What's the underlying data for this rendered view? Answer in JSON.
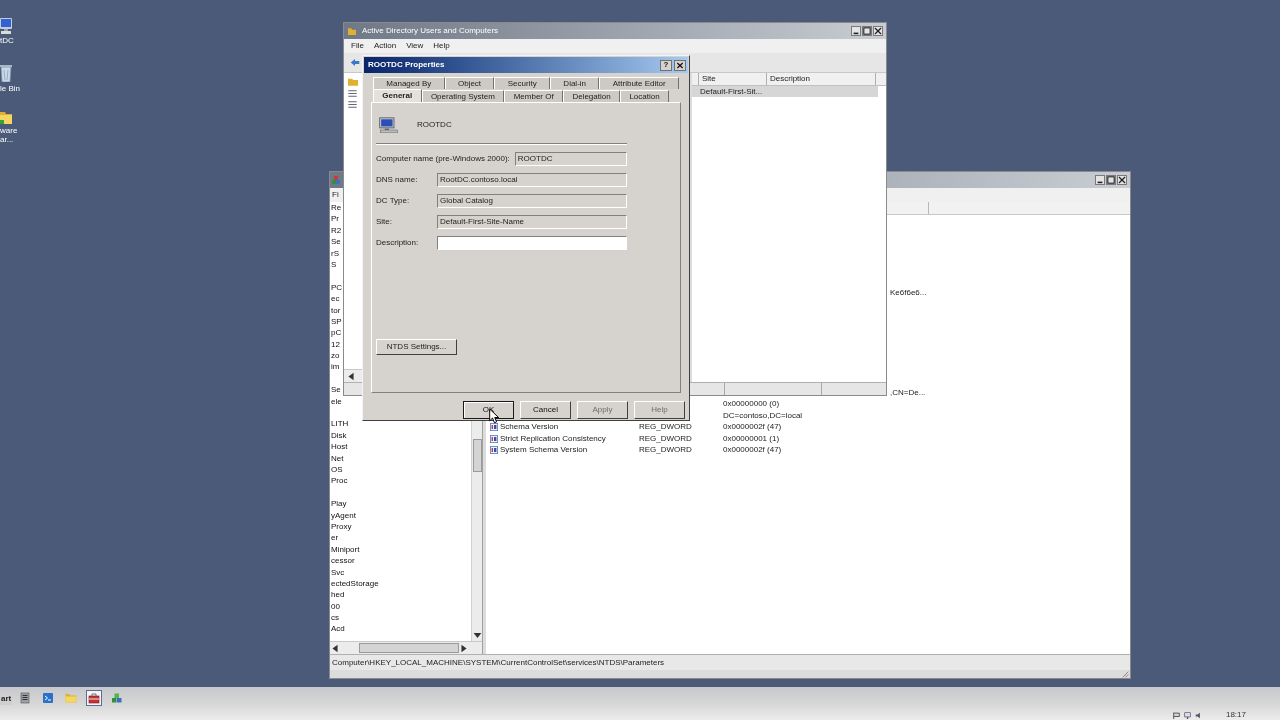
{
  "desktop_icons": [
    {
      "label": "tDC"
    },
    {
      "label": "le Bin"
    },
    {
      "label": "ware ar..."
    }
  ],
  "registry_window": {
    "menu": [
      "Fi"
    ],
    "tree_items": [
      "Re",
      "Pr",
      "R2",
      "Se",
      "rS",
      "S",
      "PC",
      "ec",
      "tor",
      "SP",
      "pC",
      "12",
      "zo",
      "im",
      "Se",
      "ele",
      "LITH",
      "Disk",
      "Host",
      "Net",
      "OS",
      "Proc",
      "Play",
      "yAgent",
      "Proxy",
      "er",
      "Miniport",
      "cessor",
      "Svc",
      "ectedStorage",
      "hed",
      "00",
      "cs",
      "Acd"
    ],
    "rows": [
      {
        "kind": "cut",
        "data": "Ke6f6e6..."
      },
      {
        "kind": "cut",
        "data": ",CN=De..."
      },
      {
        "kind": "value",
        "data": "0x00000000 (0)"
      },
      {
        "kind": "value",
        "data": "DC=contoso,DC=local"
      },
      {
        "kind": "value",
        "name": "Schema Version",
        "type": "REG_DWORD",
        "data": "0x0000002f (47)"
      },
      {
        "kind": "value",
        "name": "Strict Replication Consistency",
        "type": "REG_DWORD",
        "data": "0x00000001 (1)"
      },
      {
        "kind": "value",
        "name": "System Schema Version",
        "type": "REG_DWORD",
        "data": "0x0000002f (47)"
      }
    ],
    "status_bar": "Computer\\HKEY_LOCAL_MACHINE\\SYSTEM\\CurrentControlSet\\services\\NTDS\\Parameters"
  },
  "aduc_window": {
    "title": "Active Directory Users and Computers",
    "menu": [
      "File",
      "Action",
      "View",
      "Help"
    ],
    "columns": [
      "Site",
      "Description"
    ],
    "rows": [
      {
        "site": "Default-First-Sit...",
        "selected": true
      }
    ]
  },
  "properties_dialog": {
    "title": "ROOTDC Properties",
    "help_button": "?",
    "tab_rows": [
      [
        {
          "label": "Managed By",
          "selected": false
        },
        {
          "label": "Object",
          "selected": false
        },
        {
          "label": "Security",
          "selected": false
        },
        {
          "label": "Dial-in",
          "selected": false
        },
        {
          "label": "Attribute Editor",
          "selected": false
        }
      ],
      [
        {
          "label": "General",
          "selected": true
        },
        {
          "label": "Operating System",
          "selected": false
        },
        {
          "label": "Member Of",
          "selected": false
        },
        {
          "label": "Delegation",
          "selected": false
        },
        {
          "label": "Location",
          "selected": false
        }
      ]
    ],
    "object_name": "ROOTDC",
    "fields": [
      {
        "label": "Computer name (pre-Windows 2000):",
        "value": "ROOTDC",
        "readonly": true
      },
      {
        "label": "DNS name:",
        "value": "RootDC.contoso.local",
        "readonly": true
      },
      {
        "label": "DC Type:",
        "value": "Global Catalog",
        "readonly": true
      },
      {
        "label": "Site:",
        "value": "Default-First-Site-Name",
        "readonly": true
      },
      {
        "label": "Description:",
        "readonly": false
      }
    ],
    "ntds_button": "NTDS Settings...",
    "buttons": [
      {
        "label": "OK",
        "default": true,
        "disabled": false
      },
      {
        "label": "Cancel",
        "default": false,
        "disabled": false
      },
      {
        "label": "Apply",
        "default": false,
        "disabled": true
      },
      {
        "label": "Help",
        "default": false,
        "disabled": true
      }
    ]
  },
  "taskbar": {
    "start": "art",
    "buttons": [
      {
        "active": false
      },
      {
        "active": false
      },
      {
        "active": false
      },
      {
        "active": true
      },
      {
        "active": false
      }
    ],
    "clock": "18:17"
  }
}
